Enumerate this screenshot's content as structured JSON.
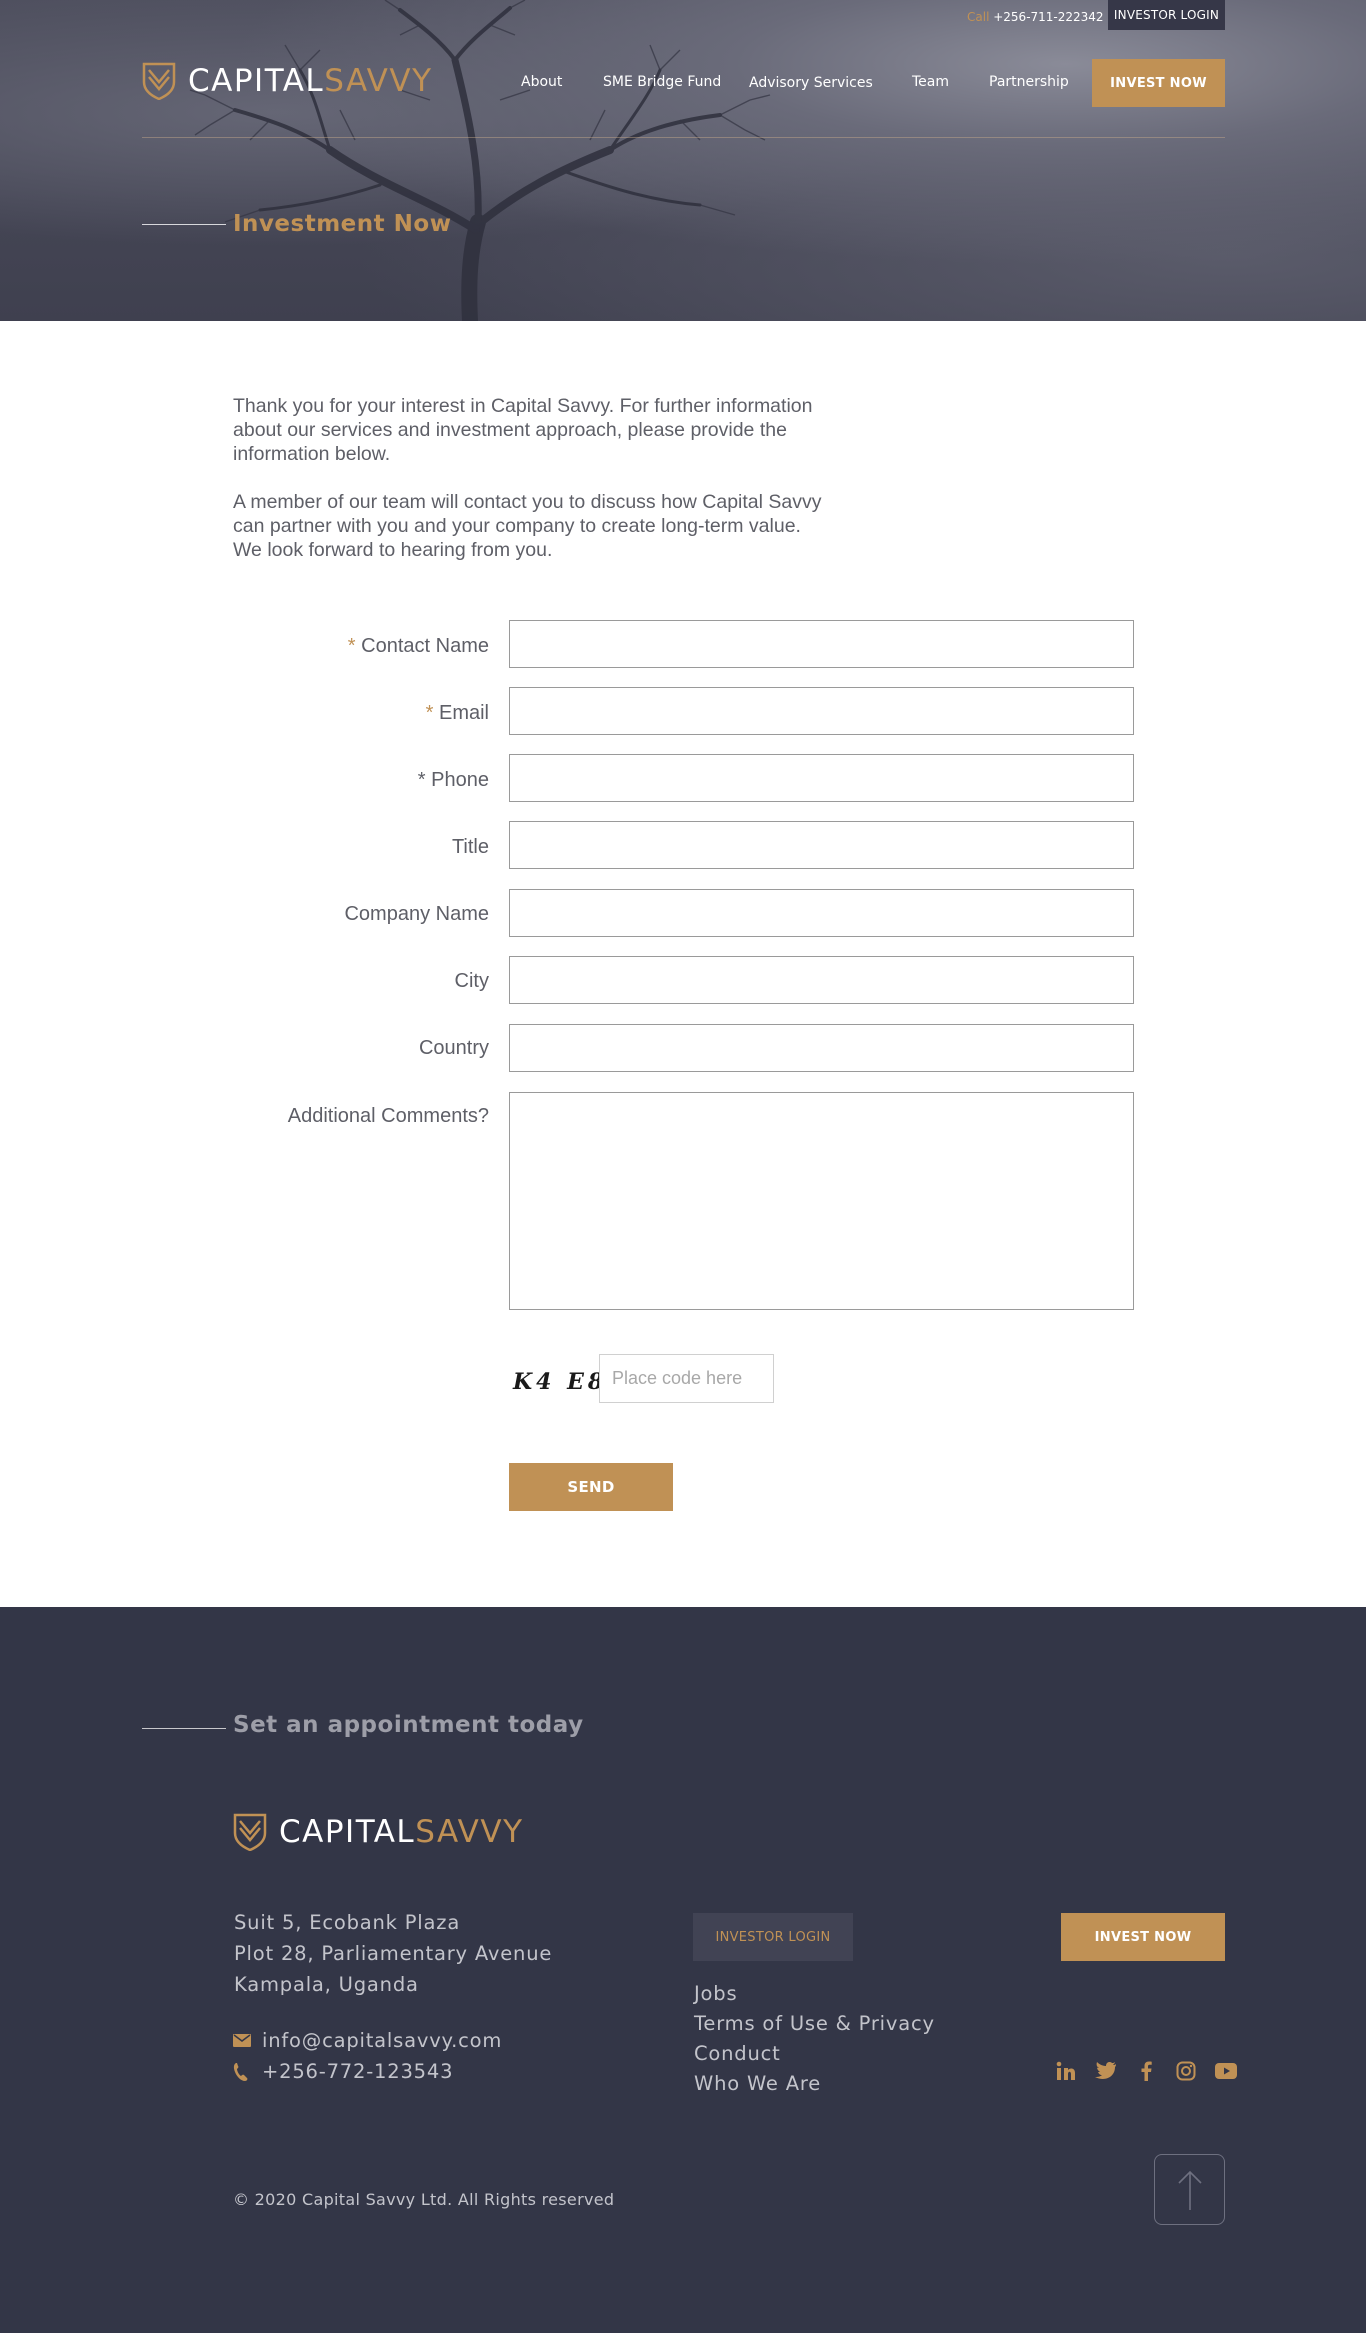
{
  "topbar": {
    "call_word": "Call",
    "phone": "+256-711-222342",
    "investor_login": "INVESTOR LOGIN"
  },
  "brand": {
    "capital": "CAPITAL",
    "savvy": "SAVVY"
  },
  "nav": {
    "items": [
      {
        "label": "About"
      },
      {
        "label": "SME Bridge Fund"
      },
      {
        "label": "Advisory Services"
      },
      {
        "label": "Team"
      },
      {
        "label": "Partnership"
      }
    ],
    "invest_now": "INVEST NOW"
  },
  "page": {
    "title": "Investment Now"
  },
  "intro": {
    "p1": [
      "Thank you for your interest in Capital Savvy.  For further information",
      "about our services and investment approach, please provide the",
      "information below."
    ],
    "p2": [
      "A member of our team will contact you to discuss  how Capital Savvy",
      "can partner with you and your company to create long-term value.",
      "We look forward to hearing from you."
    ]
  },
  "form": {
    "fields": [
      {
        "label": "Contact Name",
        "required": "*",
        "value": ""
      },
      {
        "label": "Email",
        "required": "*",
        "value": ""
      },
      {
        "label": "Phone",
        "required": "*",
        "value": ""
      },
      {
        "label": "Title",
        "required": "",
        "value": ""
      },
      {
        "label": "Company Name",
        "required": "",
        "value": ""
      },
      {
        "label": "City",
        "required": "",
        "value": ""
      },
      {
        "label": "Country",
        "required": "",
        "value": ""
      }
    ],
    "comments_label": "Additional Comments?",
    "comments_value": "",
    "captcha_text": "K4 E8",
    "captcha_placeholder": "Place code here",
    "send_label": "SEND"
  },
  "footer": {
    "appointment_title": "Set an appointment today",
    "address": [
      "Suit 5, Ecobank Plaza",
      "Plot 28, Parliamentary Avenue",
      "Kampala,  Uganda"
    ],
    "email": "info@capitalsavvy.com",
    "phone": "+256-772-123543",
    "investor_login": "INVESTOR LOGIN",
    "links": [
      "Jobs",
      "Terms of Use & Privacy",
      "Conduct",
      "Who We Are"
    ],
    "invest_now": "INVEST NOW",
    "socials": [
      "linkedin-icon",
      "twitter-icon",
      "facebook-icon",
      "instagram-icon",
      "youtube-icon"
    ],
    "copyright": "© 2020 Capital Savvy Ltd. All Rights reserved"
  },
  "colors": {
    "gold": "#c09155",
    "navy": "#333647",
    "text_gray": "#5e5f67"
  }
}
